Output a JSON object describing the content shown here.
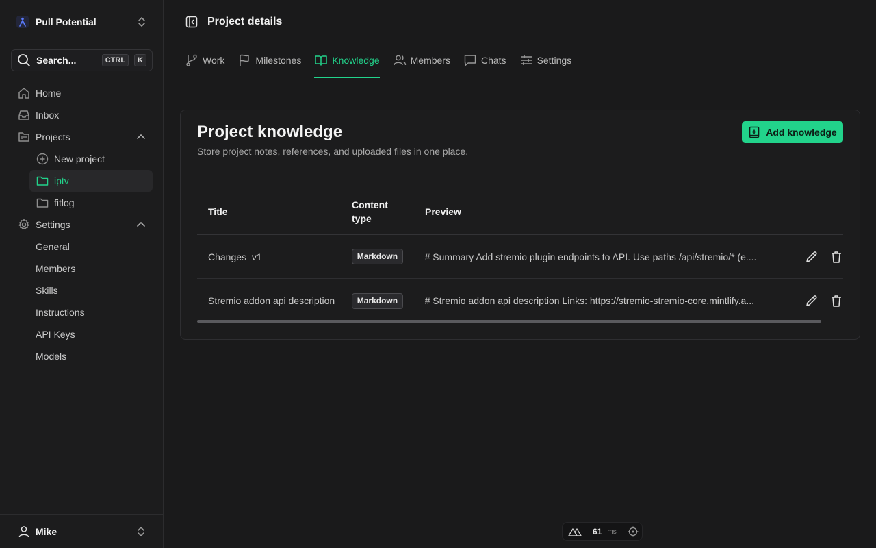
{
  "workspace": {
    "name": "Pull Potential"
  },
  "search": {
    "label": "Search...",
    "kbd1": "CTRL",
    "kbd2": "K"
  },
  "nav": {
    "home": "Home",
    "inbox": "Inbox",
    "projects": "Projects",
    "new_project": "New project",
    "project_items": [
      "iptv",
      "fitlog"
    ],
    "settings": "Settings",
    "settings_items": [
      "General",
      "Members",
      "Skills",
      "Instructions",
      "API Keys",
      "Models"
    ]
  },
  "user": {
    "name": "Mike"
  },
  "header": {
    "title": "Project details"
  },
  "tabs": [
    {
      "label": "Work",
      "icon": "git-branch-icon"
    },
    {
      "label": "Milestones",
      "icon": "flag-icon"
    },
    {
      "label": "Knowledge",
      "icon": "book-icon",
      "active": true
    },
    {
      "label": "Members",
      "icon": "users-icon"
    },
    {
      "label": "Chats",
      "icon": "chat-icon"
    },
    {
      "label": "Settings",
      "icon": "sliders-icon"
    }
  ],
  "knowledge": {
    "title": "Project knowledge",
    "subtitle": "Store project notes, references, and uploaded files in one place.",
    "add_button": "Add knowledge",
    "columns": {
      "title": "Title",
      "content_type_1": "Content",
      "content_type_2": "type",
      "preview": "Preview"
    },
    "rows": [
      {
        "title": "Changes_v1",
        "type": "Markdown",
        "preview": "# Summary Add stremio plugin endpoints to API. Use paths /api/stremio/* (e...."
      },
      {
        "title": "Stremio addon api description",
        "type": "Markdown",
        "preview": "# Stremio addon api description Links: https://stremio-stremio-core.mintlify.a..."
      }
    ]
  },
  "devbar": {
    "ms": "61",
    "unit": "ms"
  },
  "colors": {
    "accent": "#22d38b",
    "background": "#1a1a1b"
  }
}
